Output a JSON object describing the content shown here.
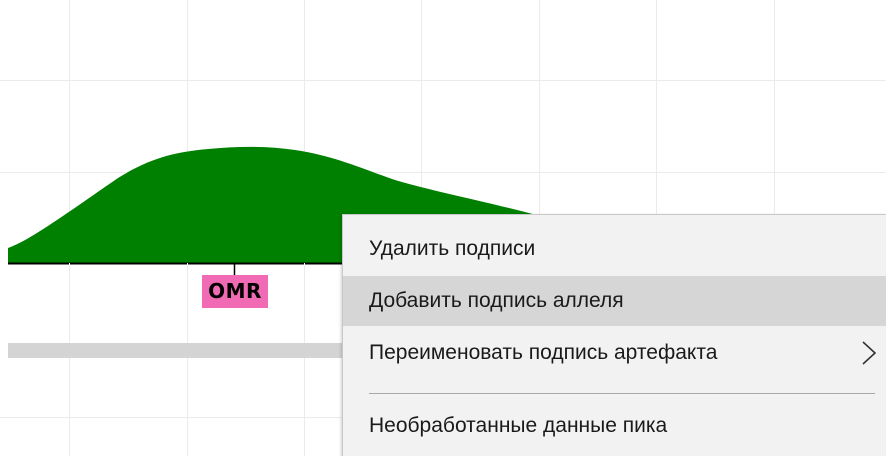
{
  "peak": {
    "label": "OMR",
    "label_color": "#f06bb4",
    "fill_color": "#008000"
  },
  "context_menu": {
    "items": [
      {
        "label": "Удалить подписи",
        "highlighted": false,
        "has_submenu": false
      },
      {
        "label": "Добавить подпись аллеля",
        "highlighted": true,
        "has_submenu": false
      },
      {
        "label": "Переименовать подпись артефакта",
        "highlighted": false,
        "has_submenu": true,
        "submenu_icon": "chevron-right-icon"
      },
      {
        "label": "Необработанные данные пика",
        "highlighted": false,
        "has_submenu": false
      }
    ],
    "background": "#f2f2f2",
    "highlight": "#d6d6d6"
  }
}
